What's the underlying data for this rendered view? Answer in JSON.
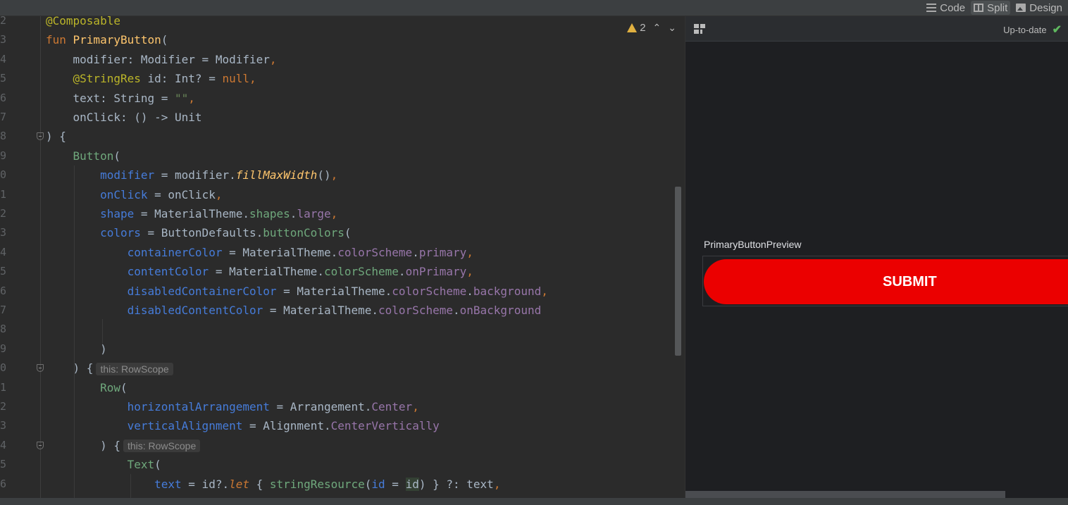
{
  "view_modes": [
    {
      "label": "Code",
      "icon": "list-icon",
      "active": false
    },
    {
      "label": "Split",
      "icon": "split-icon",
      "active": true
    },
    {
      "label": "Design",
      "icon": "image-icon",
      "active": false
    }
  ],
  "editor": {
    "warning_count": "2",
    "lines": [
      {
        "num": "2",
        "tokens": [
          [
            "@Composable",
            "k-anno"
          ]
        ]
      },
      {
        "num": "3",
        "tokens": [
          [
            "fun ",
            "k-kw"
          ],
          [
            "PrimaryButton",
            "k-fn"
          ],
          [
            "(",
            ""
          ]
        ]
      },
      {
        "num": "4",
        "tokens": [
          [
            "    modifier: Modifier = Modifier",
            ""
          ],
          [
            ",",
            "k-kw"
          ]
        ]
      },
      {
        "num": "5",
        "tokens": [
          [
            "    ",
            ""
          ],
          [
            "@StringRes",
            "k-anno"
          ],
          [
            " id: Int? = ",
            ""
          ],
          [
            "null",
            "k-null"
          ],
          [
            ",",
            "k-kw"
          ]
        ]
      },
      {
        "num": "6",
        "tokens": [
          [
            "    text: String = ",
            ""
          ],
          [
            "\"\"",
            "k-str"
          ],
          [
            ",",
            "k-kw"
          ]
        ]
      },
      {
        "num": "7",
        "tokens": [
          [
            "    onClick: () -> Unit",
            ""
          ]
        ]
      },
      {
        "num": "8",
        "tokens": [
          [
            ") {",
            ""
          ]
        ],
        "fold": true
      },
      {
        "num": "9",
        "tokens": [
          [
            "    ",
            ""
          ],
          [
            "Button",
            "k-call"
          ],
          [
            "(",
            ""
          ]
        ]
      },
      {
        "num": "0",
        "tokens": [
          [
            "        ",
            ""
          ],
          [
            "modifier",
            "k-param"
          ],
          [
            " = modifier.",
            ""
          ],
          [
            "fillMaxWidth",
            "k-ext"
          ],
          [
            "()",
            ""
          ],
          [
            ",",
            "k-kw"
          ]
        ]
      },
      {
        "num": "1",
        "tokens": [
          [
            "        ",
            ""
          ],
          [
            "onClick",
            "k-param"
          ],
          [
            " = onClick",
            ""
          ],
          [
            ",",
            "k-kw"
          ]
        ]
      },
      {
        "num": "2",
        "tokens": [
          [
            "        ",
            ""
          ],
          [
            "shape",
            "k-param"
          ],
          [
            " = MaterialTheme.",
            ""
          ],
          [
            "shapes",
            "k-call"
          ],
          [
            ".",
            ""
          ],
          [
            "large",
            "k-prop"
          ],
          [
            ",",
            "k-kw"
          ]
        ]
      },
      {
        "num": "3",
        "tokens": [
          [
            "        ",
            ""
          ],
          [
            "colors",
            "k-param"
          ],
          [
            " = ButtonDefaults.",
            ""
          ],
          [
            "buttonColors",
            "k-call"
          ],
          [
            "(",
            ""
          ]
        ]
      },
      {
        "num": "4",
        "tokens": [
          [
            "            ",
            ""
          ],
          [
            "containerColor",
            "k-param"
          ],
          [
            " = MaterialTheme.",
            ""
          ],
          [
            "colorScheme",
            "k-prop"
          ],
          [
            ".",
            ""
          ],
          [
            "primary",
            "k-prop"
          ],
          [
            ",",
            "k-kw"
          ]
        ]
      },
      {
        "num": "5",
        "tokens": [
          [
            "            ",
            ""
          ],
          [
            "contentColor",
            "k-param"
          ],
          [
            " = MaterialTheme.",
            ""
          ],
          [
            "colorScheme",
            "k-call"
          ],
          [
            ".",
            ""
          ],
          [
            "onPrimary",
            "k-prop"
          ],
          [
            ",",
            "k-kw"
          ]
        ]
      },
      {
        "num": "6",
        "tokens": [
          [
            "            ",
            ""
          ],
          [
            "disabledContainerColor",
            "k-param"
          ],
          [
            " = MaterialTheme.",
            ""
          ],
          [
            "colorScheme",
            "k-prop"
          ],
          [
            ".",
            ""
          ],
          [
            "background",
            "k-prop"
          ],
          [
            ",",
            "k-kw"
          ]
        ]
      },
      {
        "num": "7",
        "tokens": [
          [
            "            ",
            ""
          ],
          [
            "disabledContentColor",
            "k-param"
          ],
          [
            " = MaterialTheme.",
            ""
          ],
          [
            "colorScheme",
            "k-prop"
          ],
          [
            ".",
            ""
          ],
          [
            "onBackground",
            "k-prop"
          ]
        ]
      },
      {
        "num": "8",
        "tokens": [
          [
            "",
            ""
          ]
        ]
      },
      {
        "num": "9",
        "tokens": [
          [
            "        )",
            ""
          ]
        ]
      },
      {
        "num": "0",
        "tokens": [
          [
            "    ) {",
            ""
          ]
        ],
        "fold": true,
        "hint": "this: RowScope"
      },
      {
        "num": "1",
        "tokens": [
          [
            "        ",
            ""
          ],
          [
            "Row",
            "k-call"
          ],
          [
            "(",
            ""
          ]
        ]
      },
      {
        "num": "2",
        "tokens": [
          [
            "            ",
            ""
          ],
          [
            "horizontalArrangement",
            "k-param"
          ],
          [
            " = Arrangement.",
            ""
          ],
          [
            "Center",
            "k-prop"
          ],
          [
            ",",
            "k-kw"
          ]
        ]
      },
      {
        "num": "3",
        "tokens": [
          [
            "            ",
            ""
          ],
          [
            "verticalAlignment",
            "k-param"
          ],
          [
            " = Alignment.",
            ""
          ],
          [
            "CenterVertically",
            "k-prop"
          ]
        ]
      },
      {
        "num": "4",
        "tokens": [
          [
            "        ) {",
            ""
          ]
        ],
        "fold": true,
        "hint": "this: RowScope"
      },
      {
        "num": "5",
        "tokens": [
          [
            "            ",
            ""
          ],
          [
            "Text",
            "k-call"
          ],
          [
            "(",
            ""
          ]
        ]
      },
      {
        "num": "6",
        "tokens": [
          [
            "                ",
            ""
          ],
          [
            "text",
            "k-param"
          ],
          [
            " = id?.",
            ""
          ],
          [
            "let",
            "k-let"
          ],
          [
            " { ",
            ""
          ],
          [
            "stringResource",
            "k-call"
          ],
          [
            "(",
            ""
          ],
          [
            "id",
            "k-param"
          ],
          [
            " = ",
            ""
          ],
          [
            "id",
            "hl-id"
          ],
          [
            ") } ?: text",
            ""
          ],
          [
            ",",
            "k-kw"
          ]
        ]
      }
    ]
  },
  "preview": {
    "status": "Up-to-date",
    "composable_name": "PrimaryButtonPreview",
    "button_label": "SUBMIT",
    "button_color": "#eb0000"
  }
}
